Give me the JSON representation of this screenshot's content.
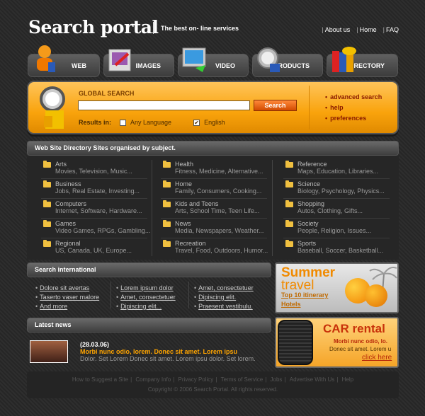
{
  "header": {
    "logo": "Search portal",
    "tagline": "The best on- line services",
    "links": [
      "About us",
      "Home",
      "FAQ"
    ]
  },
  "tabs": [
    {
      "label": "WEB",
      "icon": "person-icon"
    },
    {
      "label": "IMAGES",
      "icon": "picture-icon"
    },
    {
      "label": "VIDEO",
      "icon": "monitor-icon"
    },
    {
      "label": "PRODUCTS",
      "icon": "clock-icon"
    },
    {
      "label": "DIRECTORY",
      "icon": "books-icon"
    }
  ],
  "search": {
    "label": "GLOBAL SEARCH",
    "value": "",
    "button": "Search",
    "results_label": "Results in:",
    "option1": "Any Language",
    "option2": "English",
    "side_links": [
      "advanced search",
      "help",
      "preferences"
    ]
  },
  "directory": {
    "title": "Web Site Directory  Sites organised by subject.",
    "categories": [
      {
        "title": "Arts",
        "sub": "Movies, Television, Music..."
      },
      {
        "title": "Business",
        "sub": "Jobs, Real Estate, Investing..."
      },
      {
        "title": "Computers",
        "sub": "Internet, Software, Hardware..."
      },
      {
        "title": "Games",
        "sub": "Video Games, RPGs, Gambling..."
      },
      {
        "title": "Regional",
        "sub": "US, Canada, UK, Europe..."
      },
      {
        "title": "Health",
        "sub": "Fitness, Medicine, Alternative..."
      },
      {
        "title": "Home",
        "sub": "Family, Consumers, Cooking..."
      },
      {
        "title": "Kids and Teens",
        "sub": "Arts, School Time, Teen Life..."
      },
      {
        "title": "News",
        "sub": "Media, Newspapers, Weather..."
      },
      {
        "title": "Recreation",
        "sub": "Travel, Food, Outdoors, Humor..."
      },
      {
        "title": "Reference",
        "sub": "Maps, Education, Libraries..."
      },
      {
        "title": "Science",
        "sub": "Biology, Psychology, Physics..."
      },
      {
        "title": "Shopping",
        "sub": "Autos, Clothing, Gifts..."
      },
      {
        "title": "Society",
        "sub": "People, Religion, Issues..."
      },
      {
        "title": "Sports",
        "sub": "Baseball, Soccer, Basketball..."
      }
    ]
  },
  "international": {
    "title": "Search international",
    "links": [
      "Dolore sit avertas",
      "Taserto vaser malore",
      "And more",
      "Lorem ipsum dolor",
      "Amet, consectetuer",
      "Dipiscing elit...",
      "Amet, consectetuer",
      "Dipiscing elit.",
      "Praesent vestibulu."
    ]
  },
  "news": {
    "title": "Latest news",
    "date": "(28.03.06)",
    "headline": "Morbi nunc odio, lorem.  Donec sit amet. Lorem ipsu",
    "body": "Dolor. Set Lorem Donec sit amet. Lorem ipsu dolor. Set lorem."
  },
  "promo_travel": {
    "line1": "Summer",
    "line2": "travel",
    "link1": "Top 10 itinerary",
    "link2": "Hotels"
  },
  "promo_car": {
    "title": "CAR rental",
    "line1": "Morbi nunc odio, lo.",
    "line2": "Donec sit amet. Lorem u",
    "link": "click here"
  },
  "footer": {
    "links": [
      "How to Suggest a Site",
      "Company Info",
      "Privacy Policy",
      "Terms of Service",
      "Jobs",
      "Advertise With Us",
      "Help"
    ],
    "copyright": "Copyright © 2006 Search Portal. All rights reserved."
  },
  "colors": {
    "accent": "#f9a30c",
    "link_dark": "#8a1a00",
    "news_orange": "#ffa500"
  }
}
